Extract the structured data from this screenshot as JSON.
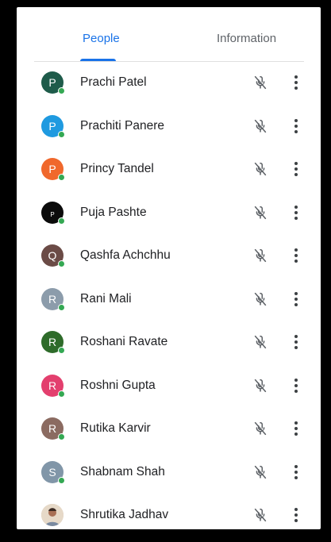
{
  "tabs": {
    "people": "People",
    "information": "Information",
    "selected": "People"
  },
  "colors": {
    "accent": "#1a73e8",
    "online": "#34a853"
  },
  "participants": [
    {
      "name": "Prachi Patel",
      "initial": "P",
      "avatar_color": "#1e5b4a",
      "mic": "muted"
    },
    {
      "name": "Prachiti Panere",
      "initial": "P",
      "avatar_color": "#1f9ae0",
      "mic": "muted"
    },
    {
      "name": "Princy Tandel",
      "initial": "P",
      "avatar_color": "#f0682c",
      "mic": "muted"
    },
    {
      "name": "Puja Pashte",
      "initial": "P",
      "avatar_color": "#0b0b0b",
      "mic": "muted"
    },
    {
      "name": "Qashfa Achchhu",
      "initial": "Q",
      "avatar_color": "#6b4b46",
      "mic": "muted"
    },
    {
      "name": "Rani Mali",
      "initial": "R",
      "avatar_color": "#8c9cab",
      "mic": "muted"
    },
    {
      "name": "Roshani Ravate",
      "initial": "R",
      "avatar_color": "#2e6b2a",
      "mic": "muted"
    },
    {
      "name": "Roshni Gupta",
      "initial": "R",
      "avatar_color": "#e33f6e",
      "mic": "muted"
    },
    {
      "name": "Rutika Karvir",
      "initial": "R",
      "avatar_color": "#8b6b61",
      "mic": "muted"
    },
    {
      "name": "Shabnam Shah",
      "initial": "S",
      "avatar_color": "#8196a8",
      "mic": "muted"
    },
    {
      "name": "Shrutika Jadhav",
      "initial": "",
      "avatar_color": "#d7c7b4",
      "mic": "muted"
    }
  ]
}
